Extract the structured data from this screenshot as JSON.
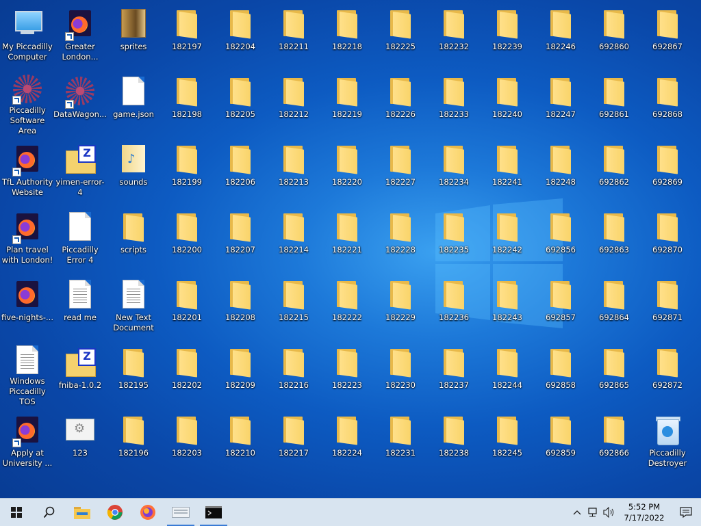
{
  "desktop": {
    "col1": [
      {
        "label": "My Piccadilly Computer",
        "kind": "pc"
      },
      {
        "label": "Piccadilly Software Area",
        "kind": "pa",
        "shortcut": true
      },
      {
        "label": "TfL Authority Website",
        "kind": "ff",
        "shortcut": true
      },
      {
        "label": "Plan travel with London!",
        "kind": "ff",
        "shortcut": true
      },
      {
        "label": "five-nights-...",
        "kind": "ff"
      },
      {
        "label": "Windows Piccadilly TOS",
        "kind": "page"
      },
      {
        "label": "Apply at University ...",
        "kind": "ff",
        "shortcut": true
      }
    ],
    "col2": [
      {
        "label": "Greater London...",
        "kind": "ff",
        "shortcut": true
      },
      {
        "label": "DataWagon...",
        "kind": "pa",
        "shortcut": true
      },
      {
        "label": "yimen-error-4",
        "kind": "zip"
      },
      {
        "label": "Piccadilly Error 4",
        "kind": "blank"
      },
      {
        "label": "read me",
        "kind": "page"
      },
      {
        "label": "fniba-1.0.2",
        "kind": "zip"
      },
      {
        "label": "123",
        "kind": "cfg"
      }
    ],
    "col3": [
      {
        "label": "sprites",
        "kind": "sprites"
      },
      {
        "label": "game.json",
        "kind": "blank"
      },
      {
        "label": "sounds",
        "kind": "sounds"
      },
      {
        "label": "scripts",
        "kind": "folder"
      },
      {
        "label": "New Text Document",
        "kind": "page"
      },
      {
        "label": "182195",
        "kind": "folder"
      },
      {
        "label": "182196",
        "kind": "folder"
      }
    ],
    "folders": [
      [
        "182197",
        "182198",
        "182199",
        "182200",
        "182201",
        "182202",
        "182203"
      ],
      [
        "182204",
        "182205",
        "182206",
        "182207",
        "182208",
        "182209",
        "182210"
      ],
      [
        "182211",
        "182212",
        "182213",
        "182214",
        "182215",
        "182216",
        "182217"
      ],
      [
        "182218",
        "182219",
        "182220",
        "182221",
        "182222",
        "182223",
        "182224"
      ],
      [
        "182225",
        "182226",
        "182227",
        "182228",
        "182229",
        "182230",
        "182231"
      ],
      [
        "182232",
        "182233",
        "182234",
        "182235",
        "182236",
        "182237",
        "182238"
      ],
      [
        "182239",
        "182240",
        "182241",
        "182242",
        "182243",
        "182244",
        "182245"
      ],
      [
        "182246",
        "182247",
        "182248",
        "692856",
        "692857",
        "692858",
        "692859"
      ],
      [
        "692860",
        "692861",
        "692862",
        "692863",
        "692864",
        "692865",
        "692866"
      ],
      [
        "692867",
        "692868",
        "692869",
        "692870",
        "692871",
        "692872"
      ]
    ],
    "recycle_bin": "Piccadilly Destroyer"
  },
  "taskbar": {
    "items": [
      {
        "name": "start-button",
        "icon": "windows-icon"
      },
      {
        "name": "search-button",
        "icon": "search-icon"
      },
      {
        "name": "file-explorer-button",
        "icon": "folder-icon"
      },
      {
        "name": "chrome-button",
        "icon": "chrome-icon"
      },
      {
        "name": "firefox-button",
        "icon": "firefox-icon"
      },
      {
        "name": "keyboard-app-button",
        "icon": "keyboard-icon"
      },
      {
        "name": "terminal-button",
        "icon": "terminal-icon"
      }
    ],
    "clock": {
      "time": "5:52 PM",
      "date": "7/17/2022"
    }
  }
}
